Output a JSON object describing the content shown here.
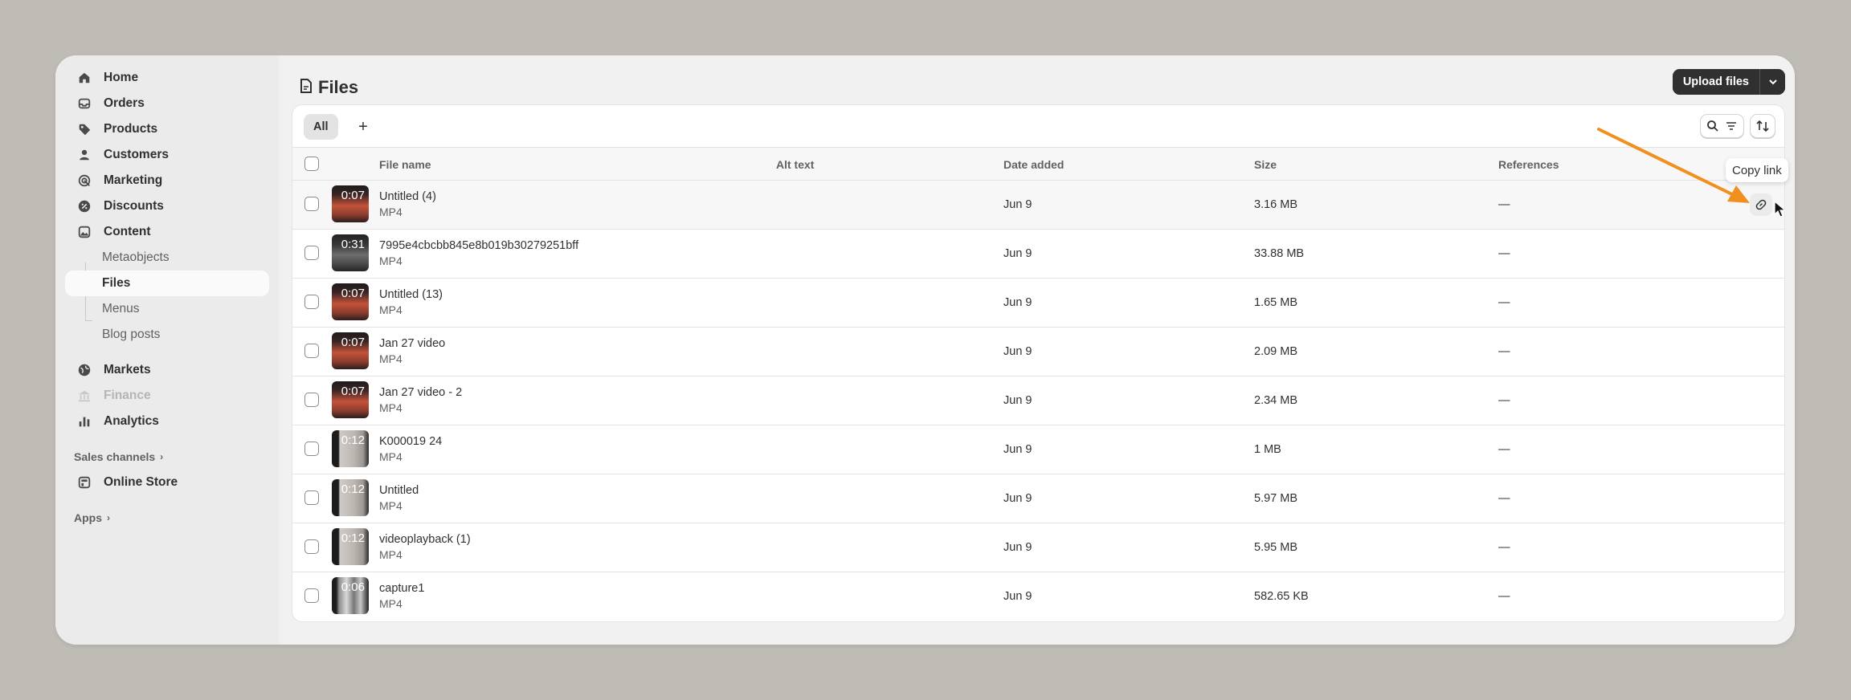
{
  "sidebar": {
    "items": [
      {
        "label": "Home",
        "icon": "home-icon"
      },
      {
        "label": "Orders",
        "icon": "inbox-icon"
      },
      {
        "label": "Products",
        "icon": "tag-icon"
      },
      {
        "label": "Customers",
        "icon": "person-icon"
      },
      {
        "label": "Marketing",
        "icon": "target-icon"
      },
      {
        "label": "Discounts",
        "icon": "discount-icon"
      },
      {
        "label": "Content",
        "icon": "image-icon"
      }
    ],
    "content_sub": [
      "Metaobjects",
      "Files",
      "Menus",
      "Blog posts"
    ],
    "items2": [
      {
        "label": "Markets",
        "icon": "globe-icon"
      },
      {
        "label": "Finance",
        "icon": "bank-icon"
      },
      {
        "label": "Analytics",
        "icon": "bar-chart-icon"
      }
    ],
    "sales_channels_label": "Sales channels",
    "online_store_label": "Online Store",
    "apps_label": "Apps"
  },
  "page": {
    "title": "Files",
    "upload_label": "Upload files"
  },
  "tabs": {
    "all": "All",
    "add": "+"
  },
  "table": {
    "headers": {
      "file_name": "File name",
      "alt_text": "Alt text",
      "date_added": "Date added",
      "size": "Size",
      "references": "References"
    },
    "rows": [
      {
        "name": "Untitled (4)",
        "type": "MP4",
        "duration": "0:07",
        "date": "Jun 9",
        "size": "3.16 MB",
        "refs": "—",
        "thumb": "warm"
      },
      {
        "name": "7995e4cbcbb845e8b019b30279251bff",
        "type": "MP4",
        "duration": "0:31",
        "date": "Jun 9",
        "size": "33.88 MB",
        "refs": "—",
        "thumb": "dark"
      },
      {
        "name": "Untitled (13)",
        "type": "MP4",
        "duration": "0:07",
        "date": "Jun 9",
        "size": "1.65 MB",
        "refs": "—",
        "thumb": "warm"
      },
      {
        "name": "Jan 27 video",
        "type": "MP4",
        "duration": "0:07",
        "date": "Jun 9",
        "size": "2.09 MB",
        "refs": "—",
        "thumb": "warm"
      },
      {
        "name": "Jan 27 video - 2",
        "type": "MP4",
        "duration": "0:07",
        "date": "Jun 9",
        "size": "2.34 MB",
        "refs": "—",
        "thumb": "warm"
      },
      {
        "name": "K000019 24",
        "type": "MP4",
        "duration": "0:12",
        "date": "Jun 9",
        "size": "1 MB",
        "refs": "—",
        "thumb": "gray"
      },
      {
        "name": "Untitled",
        "type": "MP4",
        "duration": "0:12",
        "date": "Jun 9",
        "size": "5.97 MB",
        "refs": "—",
        "thumb": "gray"
      },
      {
        "name": "videoplayback (1)",
        "type": "MP4",
        "duration": "0:12",
        "date": "Jun 9",
        "size": "5.95 MB",
        "refs": "—",
        "thumb": "gray"
      },
      {
        "name": "capture1",
        "type": "MP4",
        "duration": "0:06",
        "date": "Jun 9",
        "size": "582.65 KB",
        "refs": "—",
        "thumb": "mixed"
      }
    ]
  },
  "tooltip": {
    "copy_link": "Copy link"
  },
  "colors": {
    "accent_arrow": "#f0901e",
    "primary_button": "#303030",
    "active_nav_bg": "#fafafa"
  }
}
